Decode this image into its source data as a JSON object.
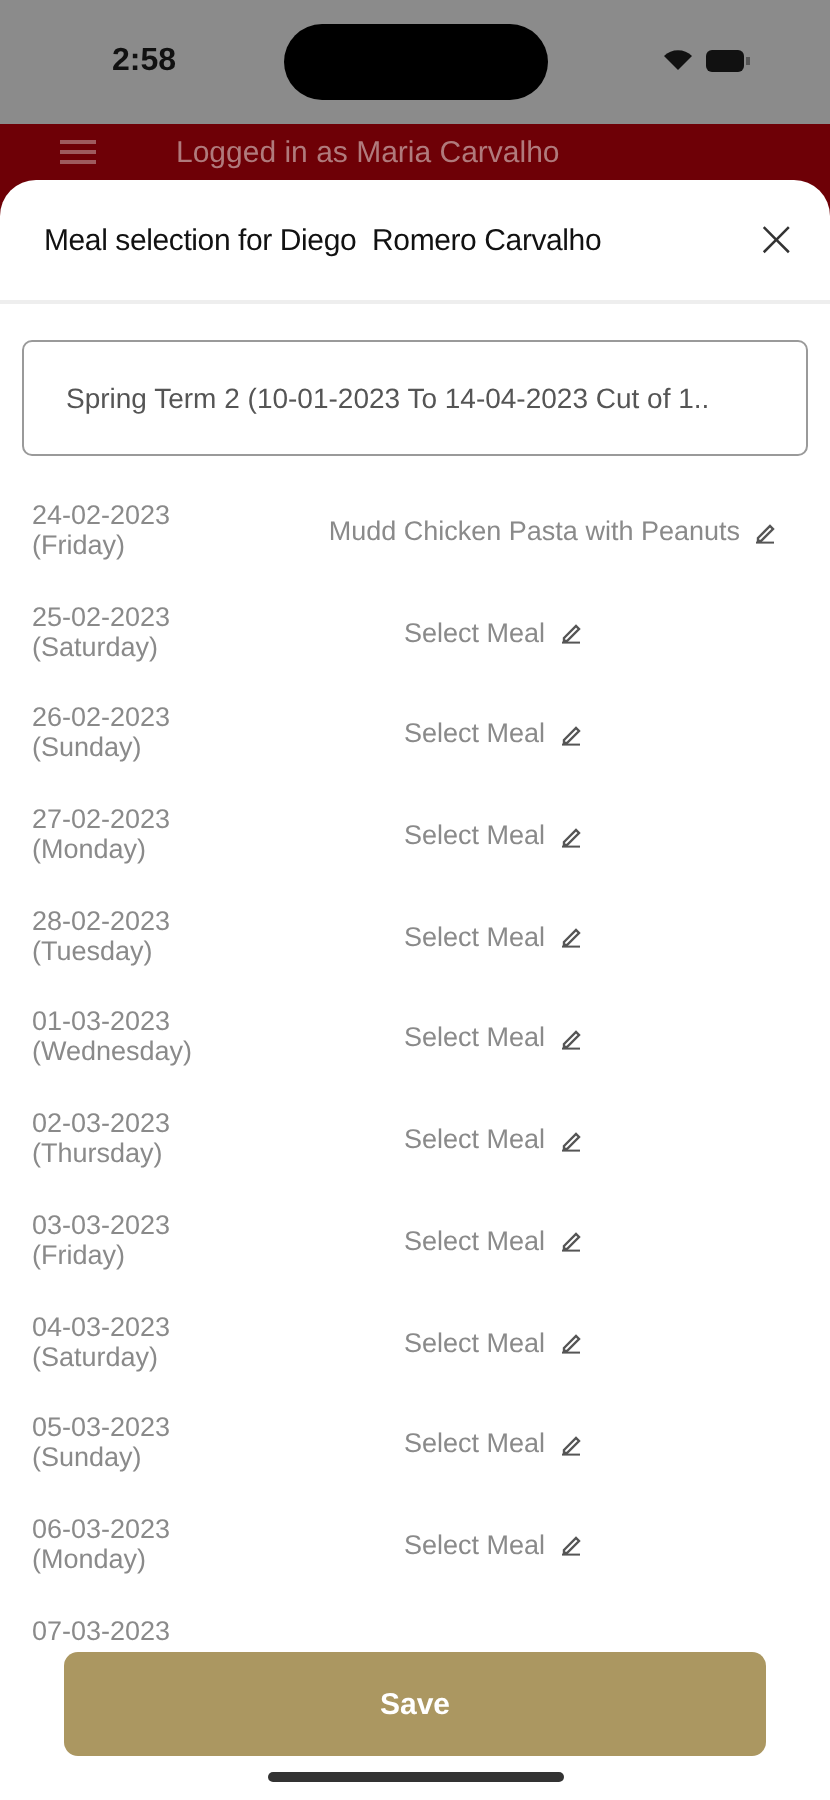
{
  "status_bar": {
    "time": "2:58"
  },
  "header": {
    "title": "Logged in as Maria Carvalho"
  },
  "sheet": {
    "title": "Meal selection for Diego  Romero Carvalho",
    "close": "×"
  },
  "term_select": {
    "value": "Spring Term 2 (10-01-2023 To 14-04-2023 Cut of 1.."
  },
  "days": [
    {
      "date": "24-02-2023",
      "weekday": "(Friday)",
      "meal": "Mudd Chicken Pasta with Peanuts"
    },
    {
      "date": "25-02-2023",
      "weekday": "(Saturday)",
      "meal": "Select Meal"
    },
    {
      "date": "26-02-2023",
      "weekday": "(Sunday)",
      "meal": "Select Meal"
    },
    {
      "date": "27-02-2023",
      "weekday": "(Monday)",
      "meal": "Select Meal"
    },
    {
      "date": "28-02-2023",
      "weekday": "(Tuesday)",
      "meal": "Select Meal"
    },
    {
      "date": "01-03-2023",
      "weekday": "(Wednesday)",
      "meal": "Select Meal"
    },
    {
      "date": "02-03-2023",
      "weekday": "(Thursday)",
      "meal": "Select Meal"
    },
    {
      "date": "03-03-2023",
      "weekday": "(Friday)",
      "meal": "Select Meal"
    },
    {
      "date": "04-03-2023",
      "weekday": "(Saturday)",
      "meal": "Select Meal"
    },
    {
      "date": "05-03-2023",
      "weekday": "(Sunday)",
      "meal": "Select Meal"
    },
    {
      "date": "06-03-2023",
      "weekday": "(Monday)",
      "meal": "Select Meal"
    },
    {
      "date": "07-03-2023"
    }
  ],
  "save_button": {
    "label": "Save"
  }
}
